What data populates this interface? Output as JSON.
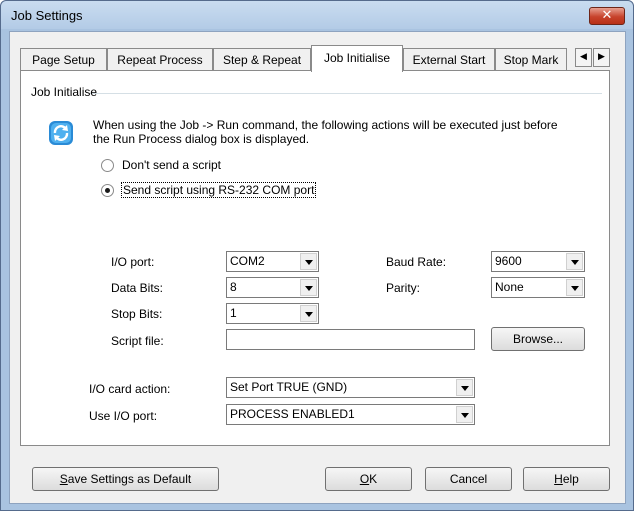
{
  "window": {
    "title": "Job Settings",
    "close_glyph": "✕"
  },
  "tabs": [
    {
      "label": "Page Setup",
      "active": false
    },
    {
      "label": "Repeat Process",
      "active": false
    },
    {
      "label": "Step & Repeat",
      "active": false
    },
    {
      "label": "Job Initialise",
      "active": true
    },
    {
      "label": "External Start",
      "active": false
    },
    {
      "label": "Stop Mark",
      "active": false
    }
  ],
  "tab_scroll": {
    "left_glyph": "◀",
    "right_glyph": "▶"
  },
  "group": {
    "title": "Job Initialise",
    "icon": "refresh-arrows-icon",
    "description": "When using the Job -> Run command, the following actions will be executed just before the Run Process dialog box is displayed."
  },
  "options": {
    "no_script": {
      "label": "Don't send a script",
      "checked": false
    },
    "rs232": {
      "label": "Send script using RS-232 COM port",
      "checked": true
    }
  },
  "serial": {
    "io_port": {
      "label": "I/O port:",
      "value": "COM2"
    },
    "baud_rate": {
      "label": "Baud Rate:",
      "value": "9600"
    },
    "data_bits": {
      "label": "Data Bits:",
      "value": "8"
    },
    "parity": {
      "label": "Parity:",
      "value": "None"
    },
    "stop_bits": {
      "label": "Stop Bits:",
      "value": "1"
    },
    "script_file": {
      "label": "Script file:",
      "value": ""
    },
    "browse_label": "Browse..."
  },
  "io_card": {
    "action": {
      "label": "I/O card action:",
      "value": "Set Port TRUE (GND)"
    },
    "use_port": {
      "label": "Use I/O port:",
      "value": "PROCESS ENABLED1"
    }
  },
  "buttons": {
    "save_default": {
      "mnemonic": "S",
      "rest": "ave Settings as Default"
    },
    "ok": {
      "mnemonic": "O",
      "rest": "K"
    },
    "cancel": "Cancel",
    "help": {
      "mnemonic": "H",
      "rest": "elp"
    }
  },
  "colors": {
    "titlebar": "#b9cfe8",
    "close_button": "#c7432c",
    "dialog_background": "#f0f0f0",
    "panel_background": "#ffffff"
  }
}
